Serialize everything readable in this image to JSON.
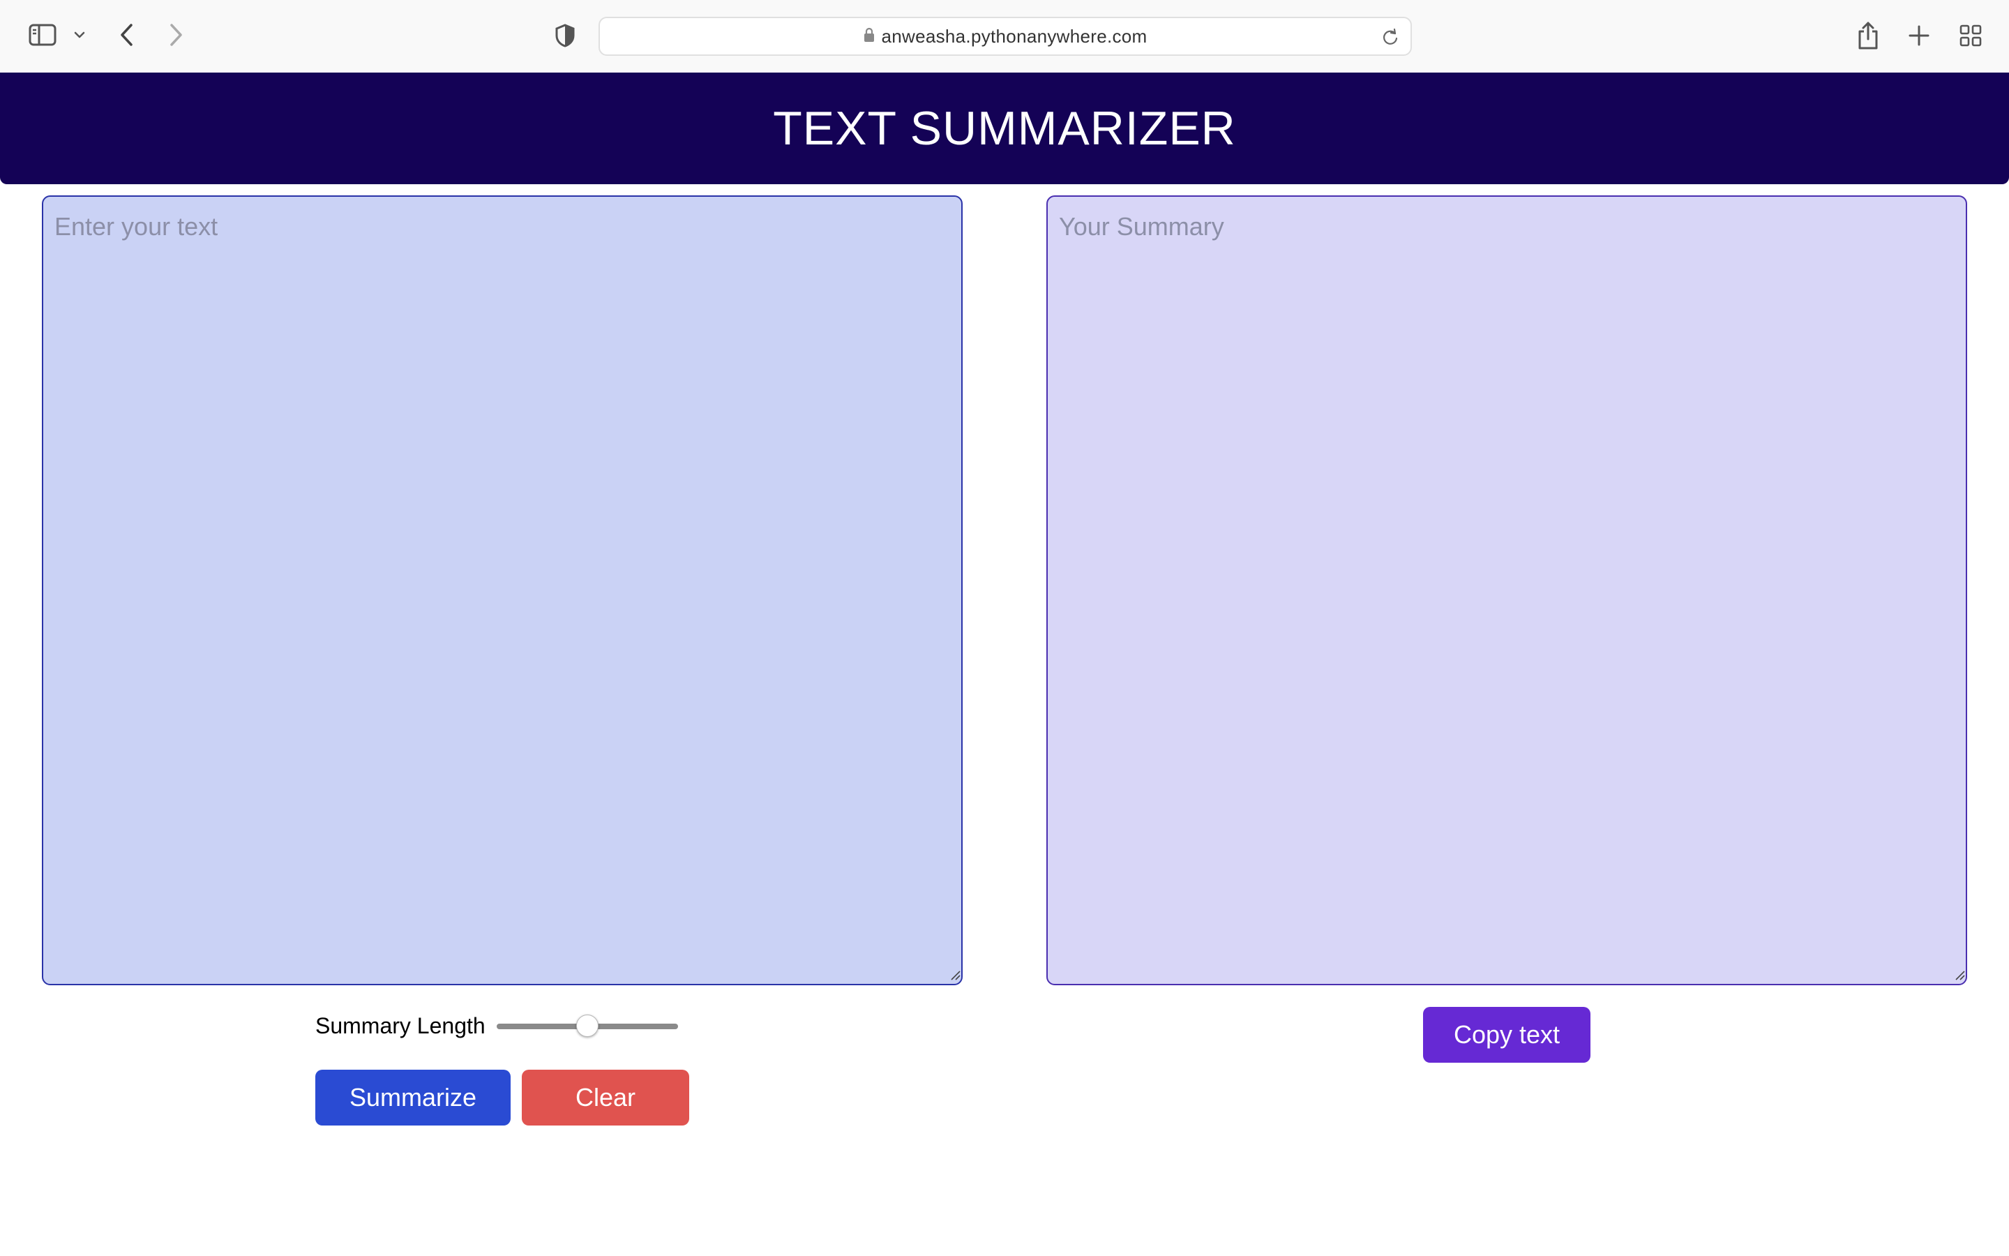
{
  "browser": {
    "url": "anweasha.pythonanywhere.com",
    "icons": {
      "sidebar": "sidebar-icon",
      "dropdown": "chevron-down-icon",
      "back": "back-arrow-icon",
      "forward": "forward-arrow-icon",
      "privacy": "shield-icon",
      "lock": "lock-icon",
      "reload": "reload-icon",
      "share": "share-icon",
      "new_tab": "plus-icon",
      "tabs_overview": "grid-icon"
    }
  },
  "header": {
    "title": "TEXT SUMMARIZER",
    "background": "#140256"
  },
  "input": {
    "placeholder": "Enter your text",
    "value": ""
  },
  "summary": {
    "placeholder": "Your Summary",
    "value": ""
  },
  "controls": {
    "length_label": "Summary Length",
    "length_value": 0.5,
    "summarize_label": "Summarize",
    "clear_label": "Clear",
    "copy_label": "Copy text"
  },
  "colors": {
    "summarize": "#2a4bd3",
    "clear": "#e0534f",
    "copy": "#6629d4",
    "input_bg": "#cad2f5",
    "summary_bg": "#d8d6f7"
  }
}
